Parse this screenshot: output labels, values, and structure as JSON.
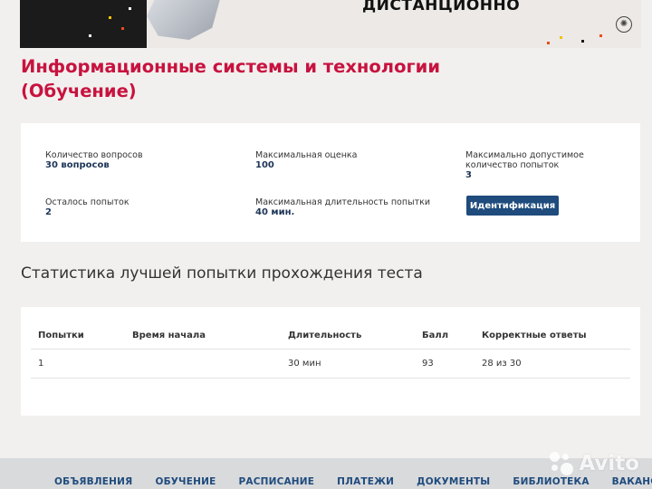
{
  "banner": {
    "title": "ДИСТАНЦИОННО",
    "logo_icon": "swirl-logo-icon"
  },
  "course": {
    "title": "Информационные системы и технологии (Обучение)"
  },
  "test_info": {
    "questions_label": "Количество вопросов",
    "questions_value": "30 вопросов",
    "max_score_label": "Максимальная оценка",
    "max_score_value": "100",
    "max_attempts_label": "Максимально допустимое количество попыток",
    "max_attempts_value": "3",
    "attempts_left_label": "Осталось попыток",
    "attempts_left_value": "2",
    "max_duration_label": "Максимальная длительность попытки",
    "max_duration_value": "40 мин.",
    "identify_button": "Идентификация"
  },
  "stats": {
    "heading": "Статистика лучшей попытки прохождения теста",
    "columns": [
      "Попытки",
      "Время начала",
      "Длительность",
      "Балл",
      "Корректные ответы"
    ],
    "rows": [
      {
        "attempt": "1",
        "start": "",
        "duration": "30 мин",
        "score": "93",
        "correct": "28 из 30"
      }
    ]
  },
  "footer_nav": [
    "ОБЪЯВЛЕНИЯ",
    "ОБУЧЕНИЕ",
    "РАСПИСАНИЕ",
    "ПЛАТЕЖИ",
    "ДОКУМЕНТЫ",
    "БИБЛИОТЕКА",
    "ВАКАНСИИ"
  ],
  "watermark": {
    "text": "Avito"
  },
  "colors": {
    "accent_red": "#c8123f",
    "primary_blue": "#1f4b7d",
    "background": "#f2f0ee"
  }
}
